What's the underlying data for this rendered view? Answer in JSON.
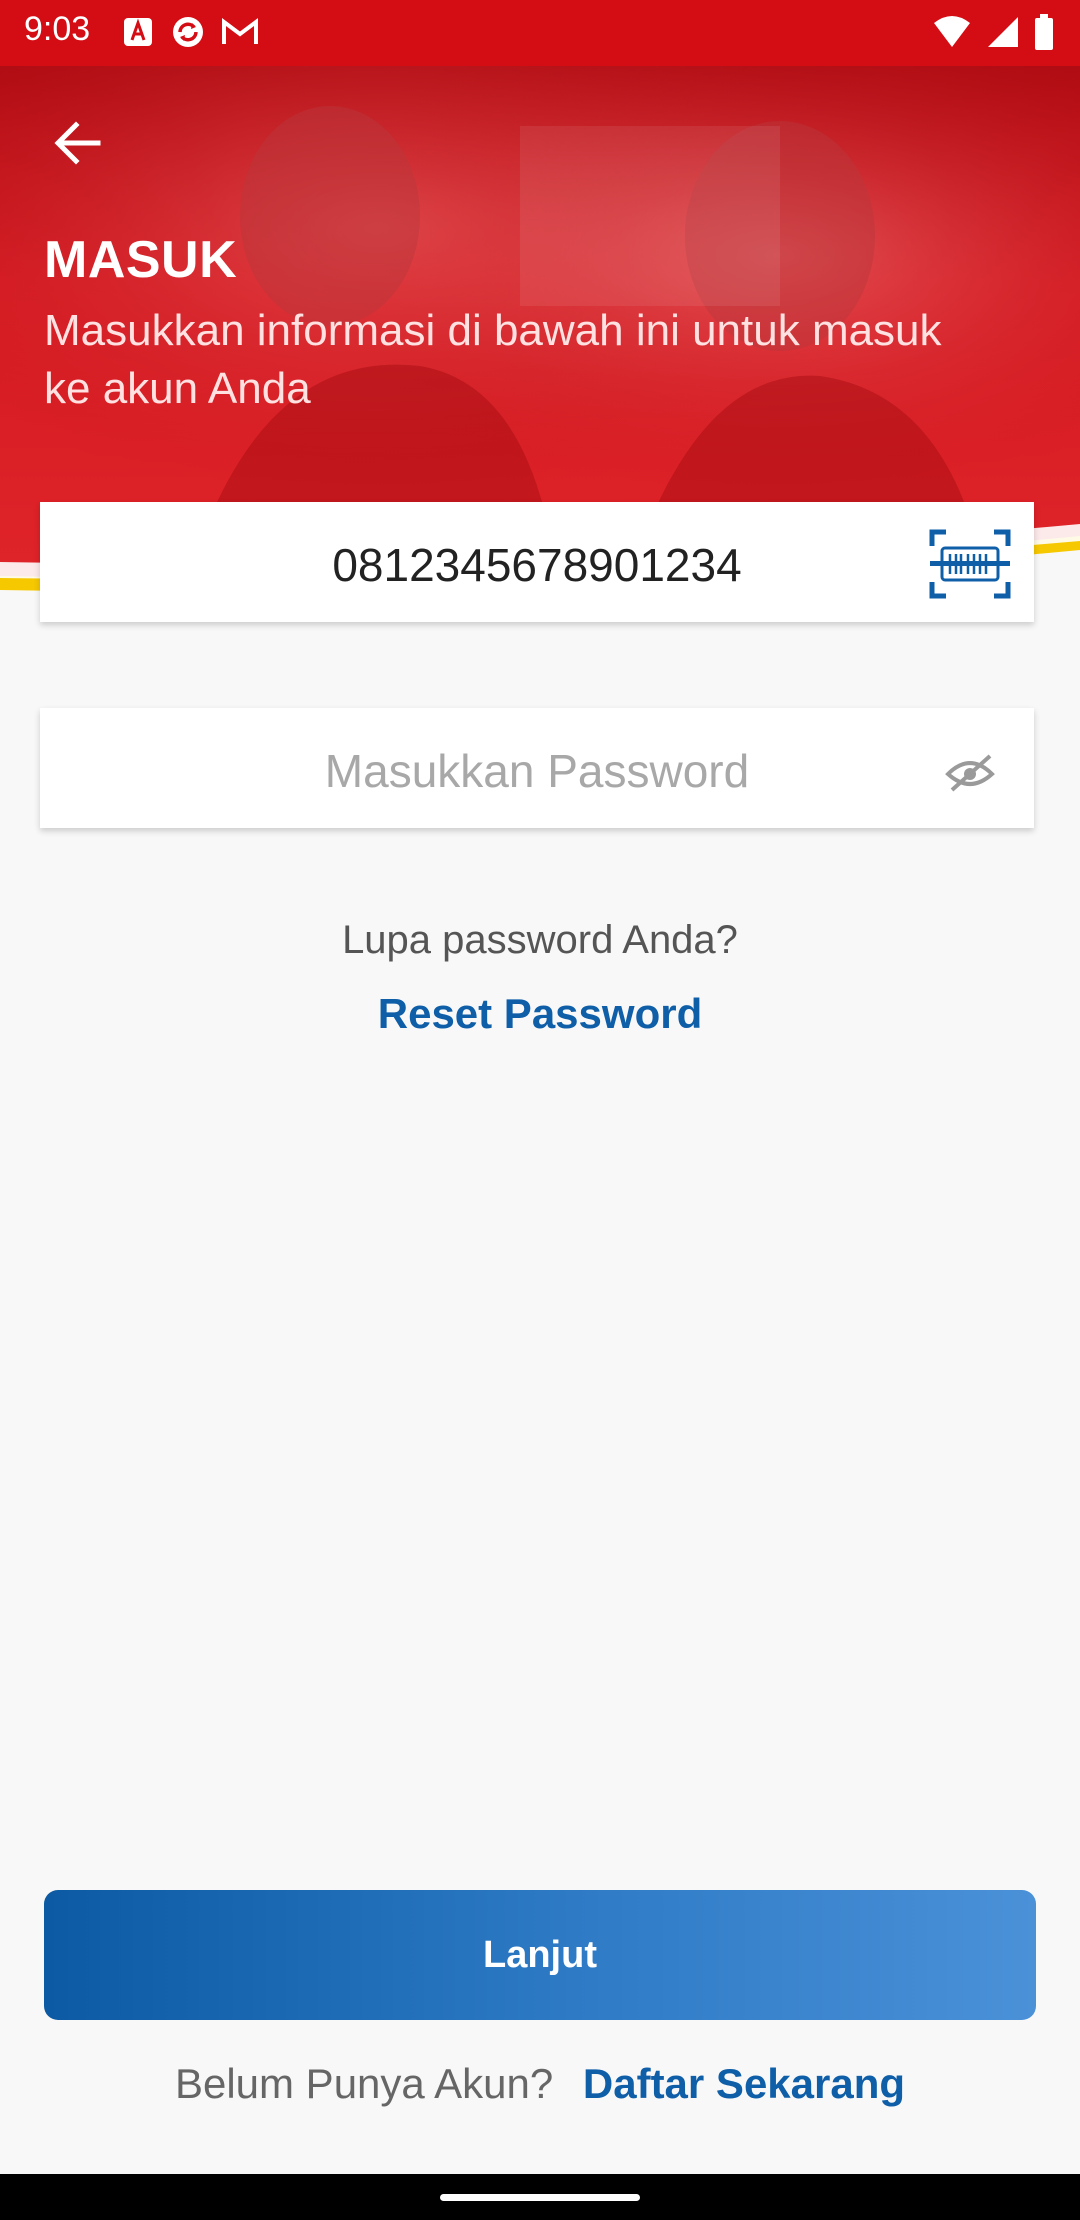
{
  "status_bar": {
    "time": "9:03"
  },
  "header": {
    "title": "MASUK",
    "subtitle": "Masukkan informasi di bawah ini untuk masuk ke akun Anda"
  },
  "form": {
    "phone_value": "0812345678901234",
    "password_placeholder": "Masukkan Password"
  },
  "forgot": {
    "question": "Lupa password Anda?",
    "reset_label": "Reset Password"
  },
  "actions": {
    "next_label": "Lanjut"
  },
  "signup": {
    "question": "Belum Punya Akun?",
    "link_label": "Daftar Sekarang"
  },
  "colors": {
    "brand_red": "#d40c14",
    "accent_yellow": "#f6c800",
    "link_blue": "#0f5ea8",
    "button_blue": "#0b5aa3"
  },
  "icons": [
    "arrow-back-icon",
    "barcode-scan-icon",
    "eye-off-icon",
    "wifi-icon",
    "signal-icon",
    "battery-icon"
  ]
}
